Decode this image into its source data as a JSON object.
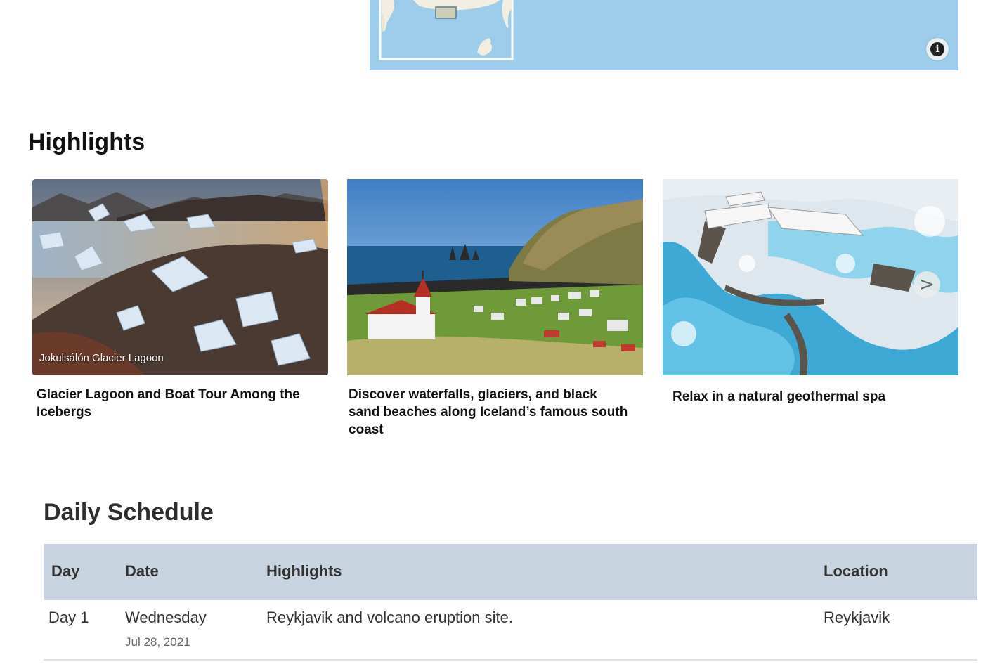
{
  "map": {
    "info_icon": "info-icon",
    "info_symbol": "i"
  },
  "highlights": {
    "title": "Highlights",
    "cards": [
      {
        "image_caption": "Jokulsálón Glacier Lagoon",
        "title": "Glacier Lagoon and  Boat Tour Among the Icebergs"
      },
      {
        "image_caption": "",
        "title": "Discover waterfalls, glaciers, and black sand beaches along Iceland’s famous south coast"
      },
      {
        "image_caption": "",
        "title": "Relax in a natural geothermal spa"
      }
    ],
    "next_symbol": ">"
  },
  "schedule": {
    "title": "Daily Schedule",
    "columns": [
      "Day",
      "Date",
      "Highlights",
      "Location"
    ],
    "rows": [
      {
        "day": "Day 1",
        "weekday": "Wednesday",
        "date": "Jul 28, 2021",
        "highlights": "Reykjavik and volcano eruption site.",
        "location": "Reykjavik"
      }
    ]
  }
}
